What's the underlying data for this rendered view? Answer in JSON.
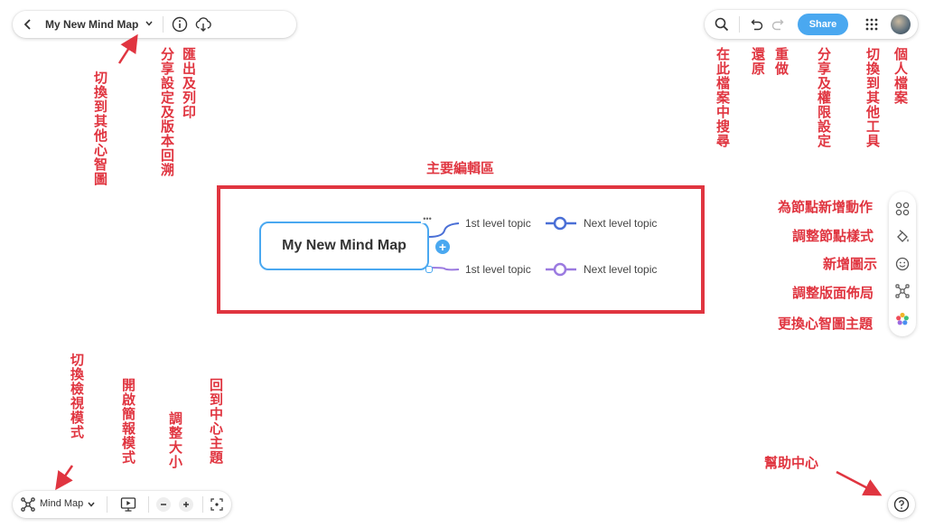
{
  "toolbar_top_left": {
    "back_icon": "chevron-left",
    "map_title": "My New Mind Map"
  },
  "toolbar_top_right": {
    "share_label": "Share"
  },
  "toolbar_bottom_left": {
    "view_mode_label": "Mind Map"
  },
  "canvas": {
    "central_topic": "My New Mind Map",
    "first_level_topics": [
      "1st level topic",
      "1st level topic"
    ],
    "next_level_topics": [
      "Next level topic",
      "Next level topic"
    ],
    "colors": {
      "branch_top": "#4a6fd6",
      "branch_bottom": "#9b7ae0",
      "central_border": "#4aa8f0",
      "highlight": "#e03540"
    }
  },
  "annotations": {
    "switch_mindmap": "切換到其他心智圖",
    "share_version": "分享設定及版本回溯",
    "export_print": "匯出及列印",
    "search_in_file": "在此檔案中搜尋",
    "undo": "還原",
    "redo": "重做",
    "share_permission": "分享及權限設定",
    "switch_tool": "切換到其他工具",
    "profile": "個人檔案",
    "main_edit_area": "主要編輯區",
    "node_action": "為節點新增動作",
    "node_style": "調整節點樣式",
    "add_icon": "新增圖示",
    "layout": "調整版面佈局",
    "theme": "更換心智圖主題",
    "switch_view": "切換檢視模式",
    "presentation": "開啟簡報模式",
    "zoom": "調整大小",
    "center": "回到中心主題",
    "help": "幫助中心"
  }
}
